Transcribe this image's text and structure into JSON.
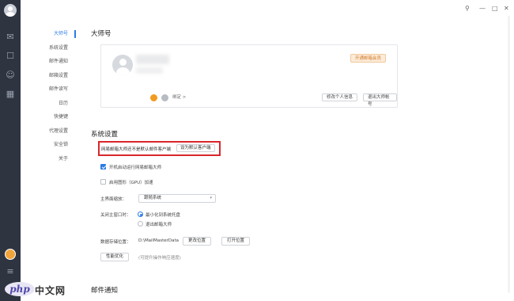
{
  "window": {
    "controls": [
      "⚲",
      "—",
      "□",
      "✕"
    ]
  },
  "nav": {
    "items": [
      {
        "label": "大师号",
        "active": true
      },
      {
        "label": "系统设置",
        "active": false
      },
      {
        "label": "邮件通知",
        "active": false
      },
      {
        "label": "邮箱设置",
        "active": false
      },
      {
        "label": "邮件读写",
        "active": false
      },
      {
        "label": "日历",
        "active": false
      },
      {
        "label": "快捷键",
        "active": false
      },
      {
        "label": "代理设置",
        "active": false
      },
      {
        "label": "安全锁",
        "active": false
      },
      {
        "label": "关于",
        "active": false
      }
    ]
  },
  "master": {
    "title": "大师号",
    "vip_button": "开通邮箱会员",
    "bind_link": "绑定 >",
    "edit_button": "修改个人信息",
    "logout_button": "退出大师帐号"
  },
  "system": {
    "title": "系统设置",
    "default_client_hint": "网易邮箱大师还不是默认邮件客户端",
    "default_client_button": "设为默认客户端",
    "autostart_label": "开机启动运行网易邮箱大师",
    "autostart_checked": true,
    "gpu_label": "启用图形（GPU）加速",
    "gpu_checked": false,
    "scale_label": "主界面缩放：",
    "scale_value": "跟随系统",
    "close_label": "关闭主窗口时：",
    "close_option1": "最小化到系统托盘",
    "close_option2": "退出邮箱大师",
    "close_selected": 1,
    "storage_label": "数据存储位置：",
    "storage_path": "D:\\MailMasterData",
    "change_location_button": "更改位置",
    "open_location_button": "打开位置",
    "optimize_button": "性能优化",
    "optimize_note": "(可提升操作响应速度)"
  },
  "mail_notify": {
    "title": "邮件通知"
  },
  "watermark": {
    "logo_text": "php",
    "site_text": "中文网"
  },
  "colors": {
    "accent": "#2d7be5",
    "highlight_border": "#d9262c",
    "rail_bg": "#2e3440"
  }
}
